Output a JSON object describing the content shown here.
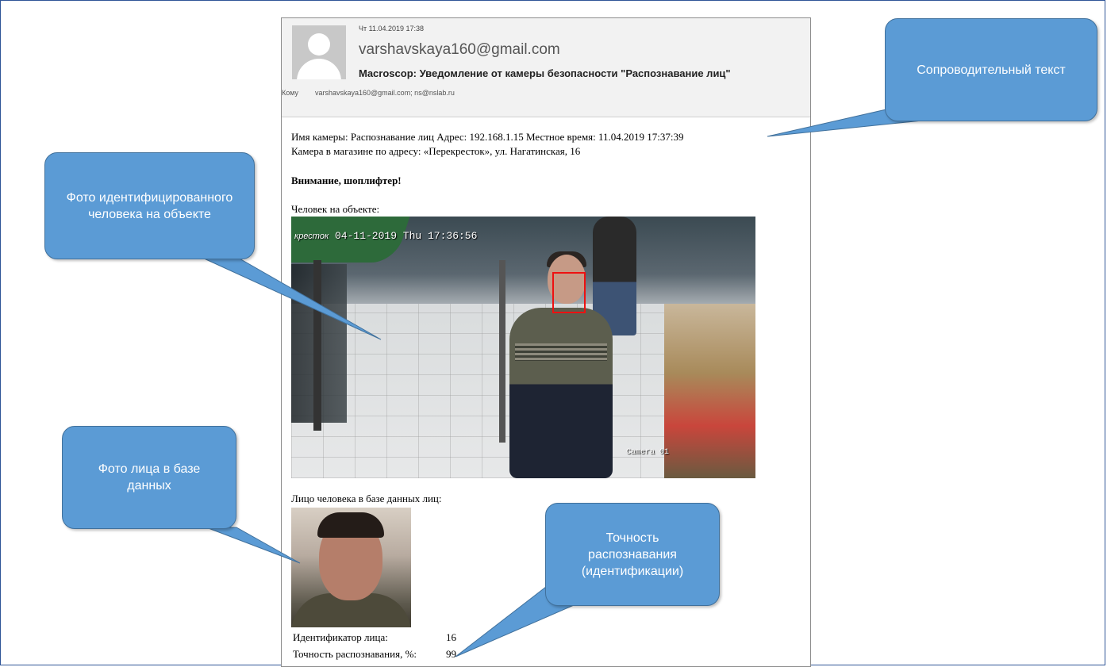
{
  "email": {
    "date": "Чт 11.04.2019 17:38",
    "sender": "varshavskaya160@gmail.com",
    "subject": "Macroscop: Уведомление от камеры безопасности \"Распознавание лиц\"",
    "to_label": "Кому",
    "to_value": "varshavskaya160@gmail.com; ns@nslab.ru",
    "avatar_icon": "person-placeholder-icon"
  },
  "message": {
    "line1": "Имя камеры: Распознавание лиц Адрес: 192.168.1.15 Местное время: 11.04.2019 17:37:39",
    "line2": "Камера в магазине по адресу:  «Перекресток», ул. Нагатинская, 16",
    "alert": "Внимание, шоплифтер!",
    "object_label": "Человек на объекте:",
    "camera_timestamp": "04-11-2019 Thu 17:36:56",
    "camera_sign": "кресток",
    "camera_name": "Camera 01",
    "db_label": "Лицо человека в базе данных лиц:",
    "face_id_label": "Идентификатор лица:",
    "face_id_value": "16",
    "accuracy_label": "Точность распознавания, %:",
    "accuracy_value": "99"
  },
  "callouts": {
    "accompanying_text": "Сопроводительный текст",
    "identified_photo": "Фото идентифицированного человека на объекте",
    "db_photo": "Фото лица в базе данных",
    "accuracy": "Точность распознавания (идентификации)"
  },
  "colors": {
    "callout_fill": "#5b9bd5",
    "callout_border": "#41719c",
    "face_box": "#ee1111",
    "frame_border": "#2f5597"
  }
}
